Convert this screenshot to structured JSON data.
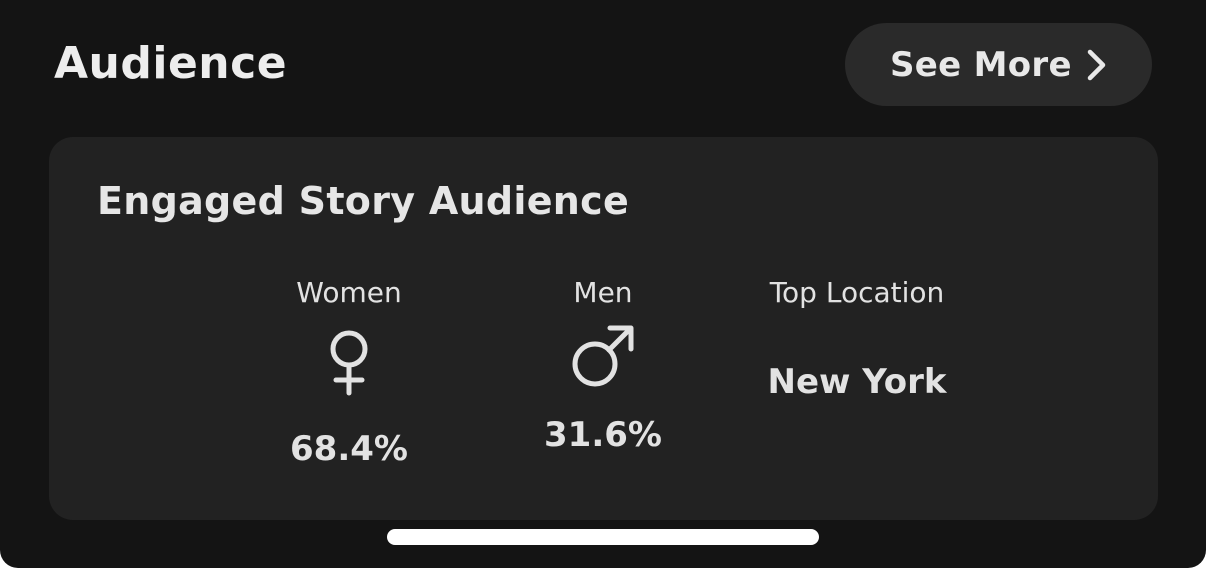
{
  "header": {
    "title": "Audience",
    "see_more_label": "See More",
    "see_more_icon": "chevron-right-icon"
  },
  "card": {
    "title": "Engaged Story Audience",
    "stats": {
      "women": {
        "label": "Women",
        "icon": "female-symbol-icon",
        "value": "68.4%"
      },
      "men": {
        "label": "Men",
        "icon": "male-symbol-icon",
        "value": "31.6%"
      },
      "top_location": {
        "label": "Top Location",
        "value": "New York"
      }
    }
  },
  "colors": {
    "background": "#141414",
    "card": "#222222",
    "button": "#2a2a2a",
    "text": "#e6e6e6",
    "home_indicator": "#ffffff"
  }
}
